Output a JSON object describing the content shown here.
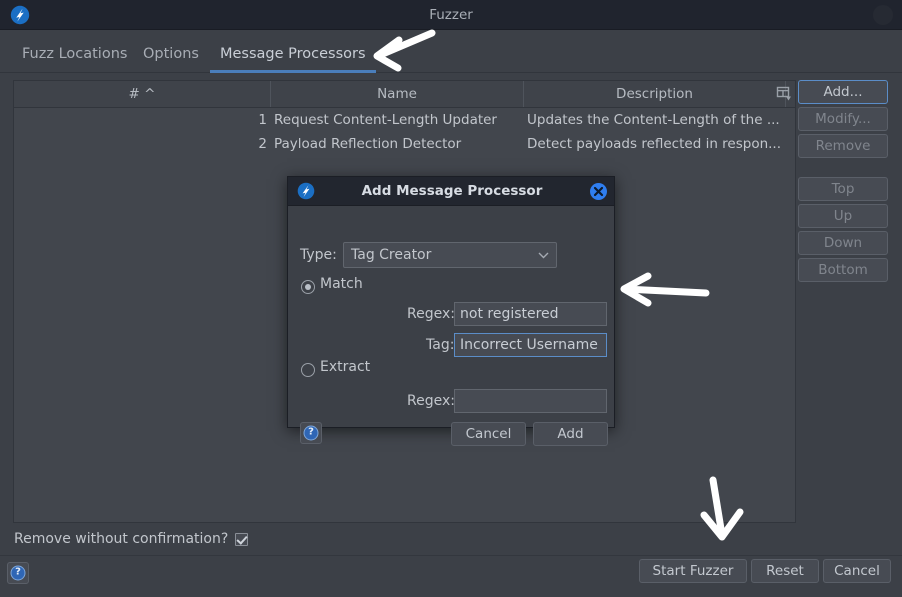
{
  "window": {
    "title": "Fuzzer",
    "app_icon": "zap-logo-icon",
    "window_control_icon": "window-dot-icon"
  },
  "tabs": [
    {
      "label": "Fuzz Locations",
      "active": false
    },
    {
      "label": "Options",
      "active": false
    },
    {
      "label": "Message Processors",
      "active": true
    }
  ],
  "table": {
    "columns": [
      "#  ^",
      "Name",
      "Description"
    ],
    "column_settings_icon": "column-settings-icon",
    "rows": [
      {
        "num": "1",
        "name": "Request Content-Length Updater",
        "desc": "Updates the Content-Length of the ..."
      },
      {
        "num": "2",
        "name": "Payload Reflection Detector",
        "desc": "Detect payloads reflected in respon..."
      }
    ]
  },
  "side_buttons": [
    {
      "label": "Add...",
      "state": "focused"
    },
    {
      "label": "Modify...",
      "state": "disabled"
    },
    {
      "label": "Remove",
      "state": "disabled"
    },
    {
      "label": "Top",
      "state": "disabled"
    },
    {
      "label": "Up",
      "state": "disabled"
    },
    {
      "label": "Down",
      "state": "disabled"
    },
    {
      "label": "Bottom",
      "state": "disabled"
    }
  ],
  "confirm": {
    "label": "Remove without confirmation?",
    "checked": true
  },
  "bottom": {
    "help_icon": "help-question-icon",
    "buttons": [
      {
        "label": "Start Fuzzer"
      },
      {
        "label": "Reset"
      },
      {
        "label": "Cancel"
      }
    ]
  },
  "dialog": {
    "title": "Add Message Processor",
    "icon": "zap-logo-icon",
    "close_icon": "close-x-icon",
    "type_label": "Type:",
    "type_value": "Tag Creator",
    "dropdown_icon": "chevron-down-icon",
    "match_label": "Match",
    "match_selected": true,
    "match_regex_label": "Regex:",
    "match_regex_value": "not registered",
    "tag_label": "Tag:",
    "tag_value": "Incorrect Username",
    "extract_label": "Extract",
    "extract_selected": false,
    "extract_regex_label": "Regex:",
    "extract_regex_value": "",
    "help_icon": "help-question-icon",
    "cancel_label": "Cancel",
    "add_label": "Add"
  },
  "colors": {
    "window_bg": "#3c4047",
    "titlebar_bg": "#20242e",
    "accent_blue": "#4a7ebb",
    "focus_blue": "#5b8dc8",
    "close_blue": "#2f7ef0",
    "text": "#c2c6cc",
    "text_dim": "#80858d"
  },
  "annotations": [
    {
      "name": "arrow-to-message-processors-tab"
    },
    {
      "name": "arrow-to-tag-field"
    },
    {
      "name": "arrow-to-start-fuzzer-button"
    }
  ]
}
